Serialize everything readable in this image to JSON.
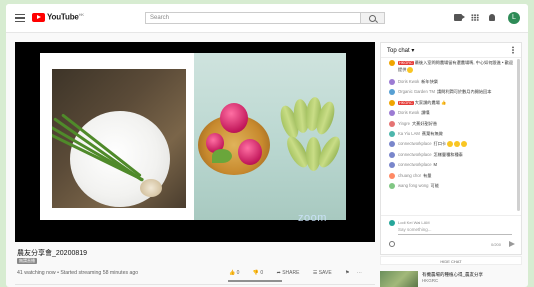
{
  "header": {
    "logo_text": "YouTube",
    "logo_country": "HK",
    "search_placeholder": "Search",
    "avatar_letter": "L"
  },
  "video": {
    "watermark": "zoom",
    "title": "農友分享會_20200819",
    "tag": "無謂直播",
    "meta": "41 watching now • Started streaming 58 minutes ago",
    "like_count": "0",
    "dislike_count": "0",
    "share_label": "SHARE",
    "save_label": "SAVE"
  },
  "chat": {
    "title": "Top chat",
    "messages": [
      {
        "badge": "HKGRC",
        "name": "",
        "text": "最後入室問問農場留有還農場嗎, 中心如何跟進 • 歡迎提供",
        "emoji": 1,
        "color": "#f0a500"
      },
      {
        "badge": "",
        "name": "Doris Kwok",
        "text": "新年快樂",
        "emoji": 0,
        "color": "#9c7bd3"
      },
      {
        "badge": "",
        "name": "Organic Garden TM",
        "text": "請問利潤可於數月內開始回本",
        "emoji": 0,
        "color": "#57a0d3"
      },
      {
        "badge": "HKGRC",
        "name": "",
        "text": "大家讚的農場 👍",
        "emoji": 0,
        "color": "#f0a500"
      },
      {
        "badge": "",
        "name": "Doris Kwok",
        "text": "讚嘆",
        "emoji": 0,
        "color": "#9c7bd3"
      },
      {
        "badge": "",
        "name": "Yingre",
        "text": "大蕉好甜好香",
        "emoji": 0,
        "color": "#e57373"
      },
      {
        "badge": "",
        "name": "Ka Yiu LAM",
        "text": "蕉葉有無做",
        "emoji": 0,
        "color": "#4db6ac"
      },
      {
        "badge": "",
        "name": "connectworkplace",
        "text": "打口卡",
        "emoji": 3,
        "color": "#7986cb"
      },
      {
        "badge": "",
        "name": "connectworkplace",
        "text": "怎樣豐種和種泰",
        "emoji": 0,
        "color": "#7986cb"
      },
      {
        "badge": "",
        "name": "connectworkplace",
        "text": "M",
        "emoji": 0,
        "color": "#7986cb"
      },
      {
        "badge": "",
        "name": "chuang chor",
        "text": "有量",
        "emoji": 0,
        "color": "#ff8a65"
      },
      {
        "badge": "",
        "name": "wang fong wong",
        "text": "可能",
        "emoji": 0,
        "color": "#81c784"
      }
    ],
    "input_name": "Lodi Kei Wai LAM",
    "input_placeholder": "Say something...",
    "char_count": "0/200",
    "hide_label": "HIDE CHAT"
  },
  "sidebar": {
    "next_title": "有機農場的種植心得_農友分享",
    "next_channel": "HKGRC"
  }
}
